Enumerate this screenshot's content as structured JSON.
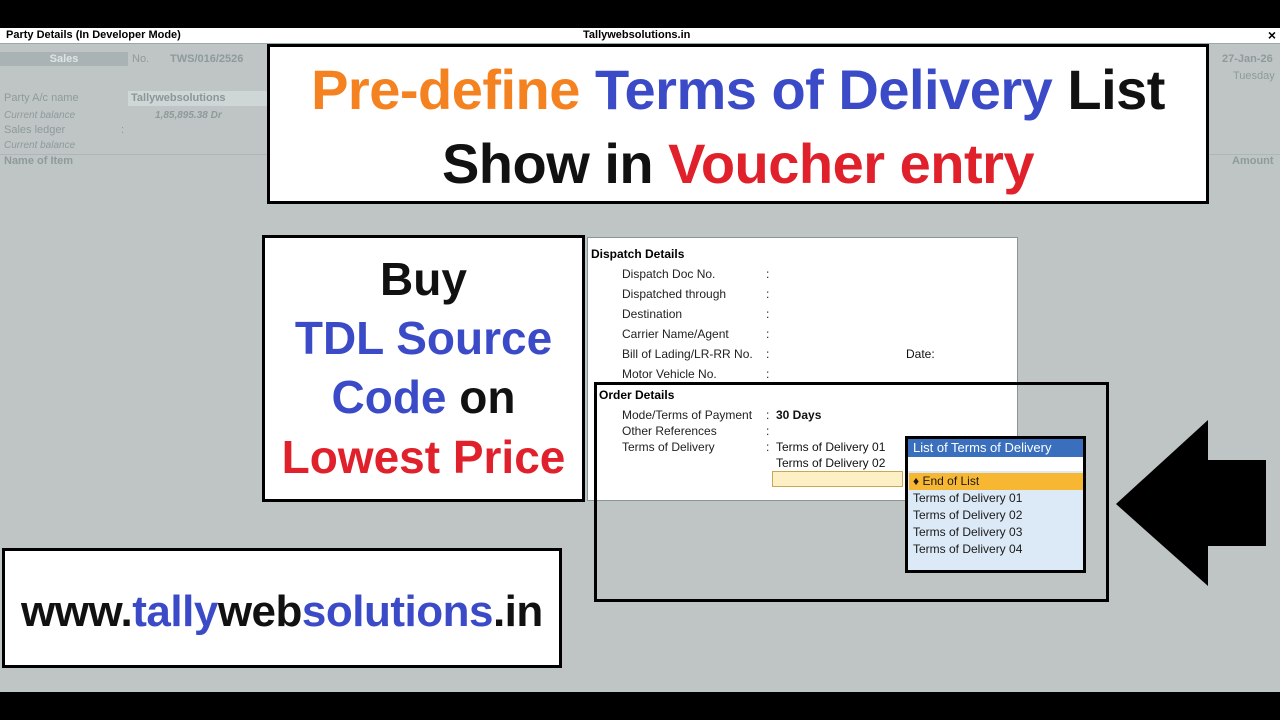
{
  "window": {
    "title_left": "Party Details (In Developer Mode)",
    "title_center": "Tallywebsolutions.in",
    "close_label": "×"
  },
  "background": {
    "voucher_type": "Sales",
    "no_label": "No.",
    "voucher_no": "TWS/016/2526",
    "date": "27-Jan-26",
    "day": "Tuesday",
    "party_label": "Party A/c name",
    "party_value": "Tallywebsolutions",
    "current_balance_label": "Current balance",
    "current_balance_value": "1,85,895.38 Dr",
    "sales_ledger_label": "Sales ledger",
    "sales_ledger_colon": ":",
    "current_balance_label2": "Current balance",
    "name_of_item": "Name of Item",
    "amount": "Amount"
  },
  "banner": {
    "line1": [
      "Pre-define",
      " Terms of Delivery",
      " List"
    ],
    "line2": [
      "Show in",
      " Voucher entry"
    ]
  },
  "promo": {
    "buy": "Buy",
    "tdl_source": "TDL Source",
    "code": "Code",
    "on": " on",
    "lowest_price": "Lowest Price"
  },
  "website": {
    "parts": [
      "www.",
      "tally",
      "web",
      "solutions",
      ".in"
    ]
  },
  "dispatch": {
    "section_title": "Dispatch Details",
    "colon": ":",
    "fields": [
      {
        "label": "Dispatch Doc No."
      },
      {
        "label": "Dispatched through"
      },
      {
        "label": "Destination"
      },
      {
        "label": "Carrier Name/Agent"
      },
      {
        "label": "Bill of Lading/LR-RR No.",
        "extra": "Date:"
      },
      {
        "label": "Motor Vehicle No."
      }
    ]
  },
  "order": {
    "section_title": "Order Details",
    "mode_label": "Mode/Terms of Payment",
    "mode_value": "30 Days",
    "other_ref_label": "Other References",
    "tod_label": "Terms of Delivery",
    "tod_values": [
      "Terms of Delivery 01",
      "Terms of Delivery 02"
    ]
  },
  "popup": {
    "title": "List of Terms of Delivery",
    "selected": "♦ End of List",
    "items": [
      "Terms of Delivery 01",
      "Terms of Delivery 02",
      "Terms of Delivery 03",
      "Terms of Delivery 04"
    ]
  },
  "colors": {
    "orange": "#f58220",
    "blue": "#3b4bc8",
    "red": "#e0202a",
    "popup_header": "#3a6fbd",
    "popup_selected": "#f7b733"
  },
  "icons": {
    "arrow": "left-arrow-icon"
  }
}
